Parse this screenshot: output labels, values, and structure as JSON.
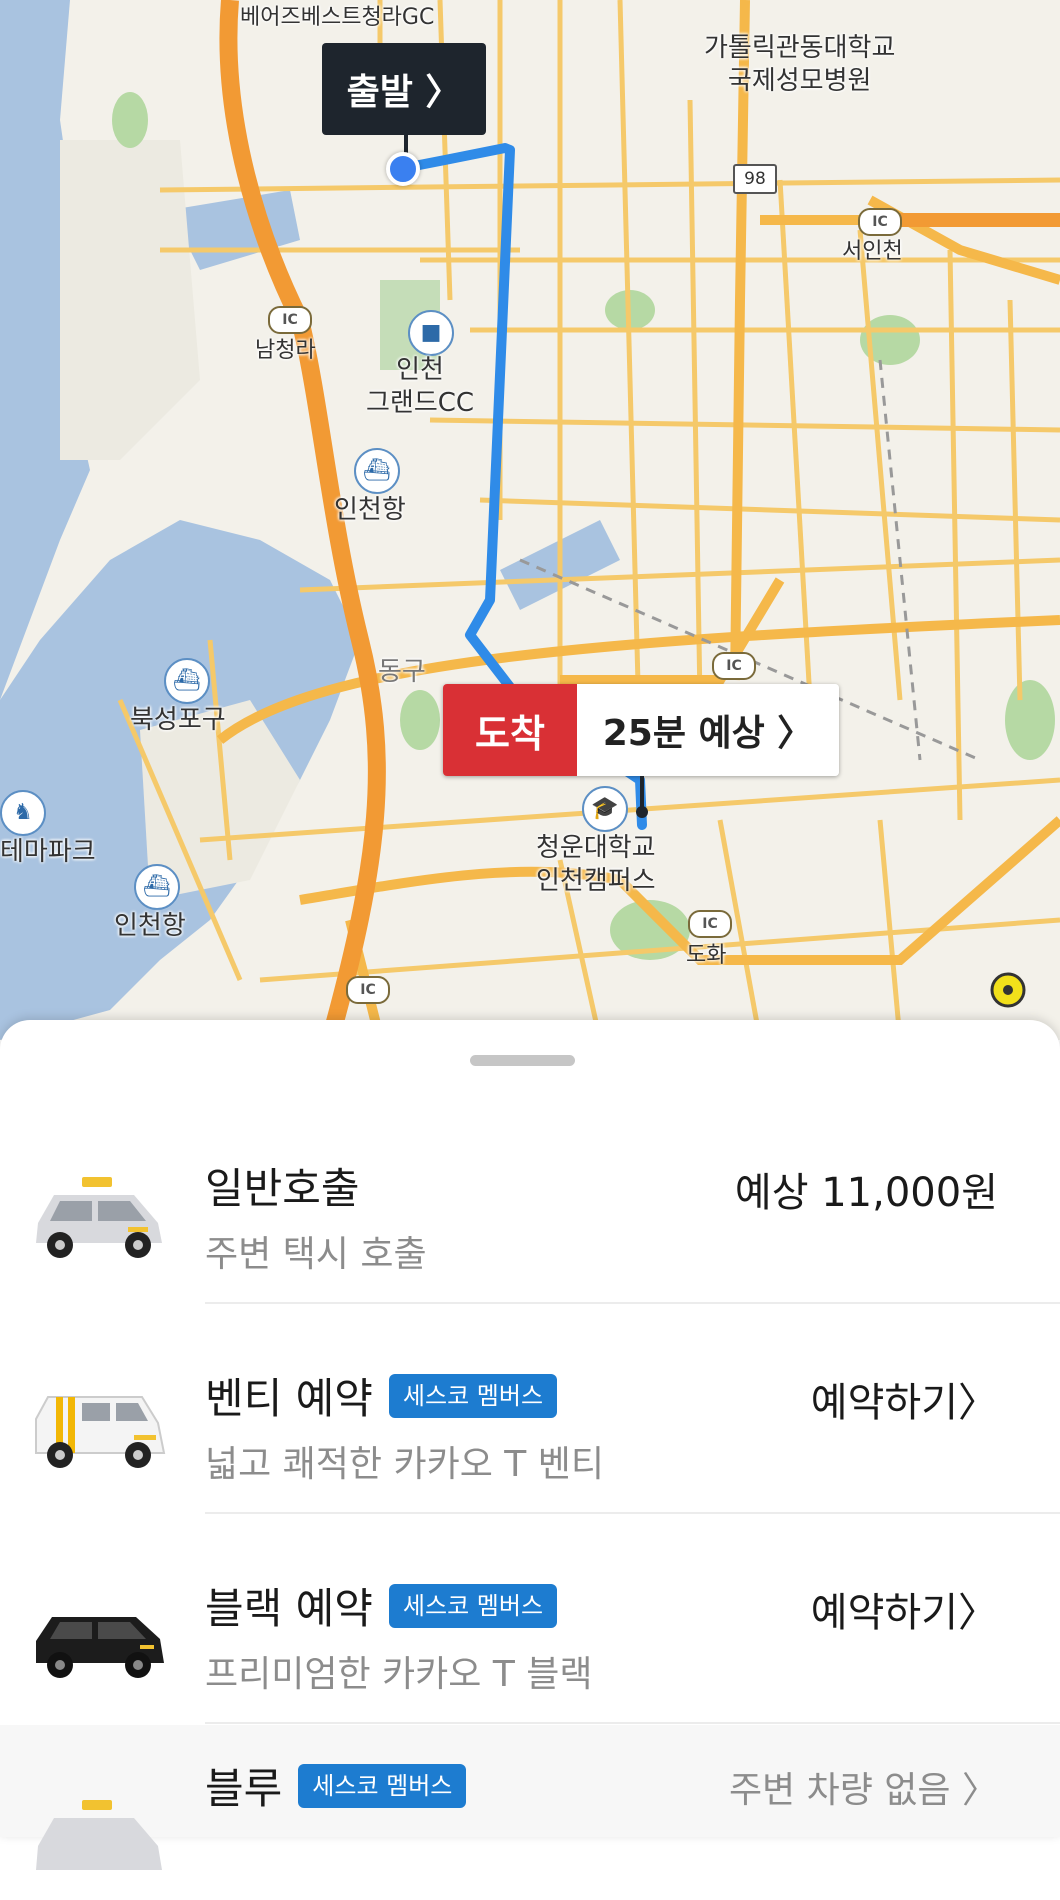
{
  "map": {
    "labels": {
      "bears_best": "베어즈베스트청라GC",
      "catholic_line1": "가톨릭관동대학교",
      "catholic_line2": "국제성모병원",
      "seo_incheon": "서인천",
      "namcheongna": "남청라",
      "incheon_grand_line1": "인천",
      "incheon_grand_line2": "그랜드CC",
      "incheon_port_top": "인천항",
      "dong_gu": "동구",
      "bukseong_port": "북성포구",
      "theme_park": "테마파크",
      "incheon_port_bottom": "인천항",
      "cheongun_line1": "청운대학교",
      "cheongun_line2": "인천캠퍼스",
      "dohwa": "도화",
      "route_98": "98",
      "ic": "IC"
    },
    "departure_label": "출발 〉",
    "arrival_label": "도착",
    "eta_label": "25분 예상 〉",
    "icons": {
      "poi": "ship-icon",
      "school": "graduation-cap-icon",
      "golf": "golf-icon",
      "park": "horse-icon"
    },
    "colors": {
      "route": "#2f8be8",
      "highway": "#f7a33a",
      "road": "#f5c96a",
      "water": "#a9c3e0",
      "park": "#b6d9a4"
    }
  },
  "sheet": {
    "options": [
      {
        "title": "일반호출",
        "subtitle": "주변 택시 호출",
        "right": "예상 11,000원",
        "badge": ""
      },
      {
        "title": "벤티 예약",
        "subtitle": "넓고 쾌적한 카카오 T 벤티",
        "right": "예약하기〉",
        "badge": "세스코 멤버스"
      },
      {
        "title": "블랙 예약",
        "subtitle": "프리미엄한 카카오 T 블랙",
        "right": "예약하기〉",
        "badge": "세스코 멤버스"
      },
      {
        "title": "블루",
        "subtitle": "",
        "right": "주변 차량 없음 〉",
        "badge": "세스코 멤버스"
      }
    ]
  }
}
